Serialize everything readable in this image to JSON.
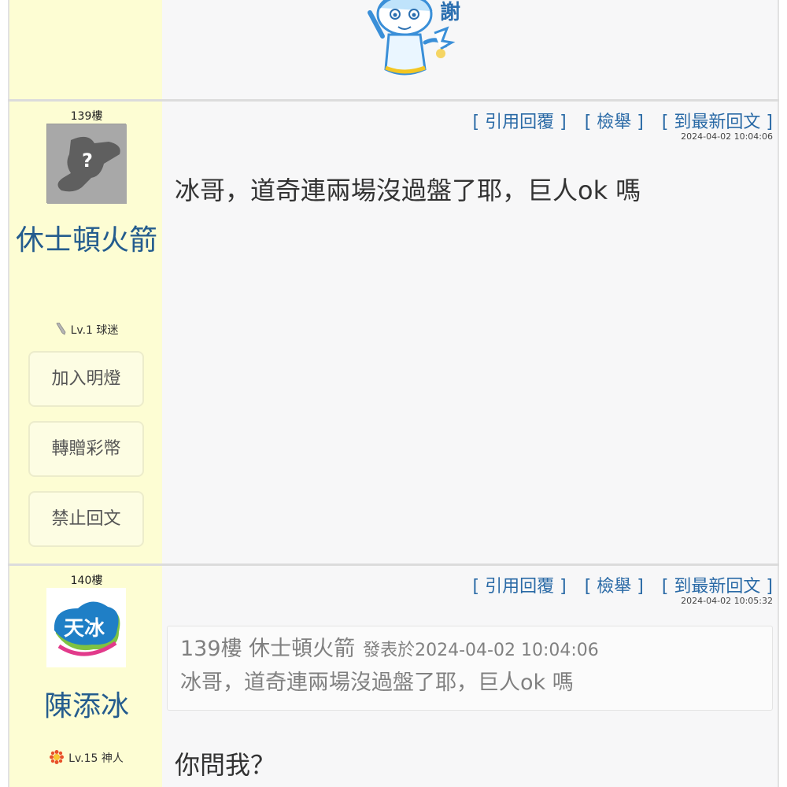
{
  "top_post": {
    "sticker_text": "謝"
  },
  "posts": [
    {
      "floor": "139樓",
      "username": "休士頓火箭",
      "level": "Lv.1 球迷",
      "buttons": [
        "加入明燈",
        "轉贈彩幣",
        "禁止回文"
      ],
      "actions": [
        "[ 引用回覆 ]",
        "[ 檢舉 ]",
        "[ 到最新回文 ]"
      ],
      "timestamp": "2024-04-02 10:04:06",
      "text": "冰哥，道奇連兩場沒過盤了耶，巨人ok 嗎"
    },
    {
      "floor": "140樓",
      "username": "陳添冰",
      "avatar_text": "天冰",
      "level": "Lv.15 神人",
      "actions": [
        "[ 引用回覆 ]",
        "[ 檢舉 ]",
        "[ 到最新回文 ]"
      ],
      "timestamp": "2024-04-02 10:05:32",
      "quote": {
        "header": "139樓 休士頓火箭",
        "posted": "發表於2024-04-02 10:04:06",
        "text": "冰哥，道奇連兩場沒過盤了耶，巨人ok 嗎"
      },
      "text": "你問我？"
    }
  ]
}
